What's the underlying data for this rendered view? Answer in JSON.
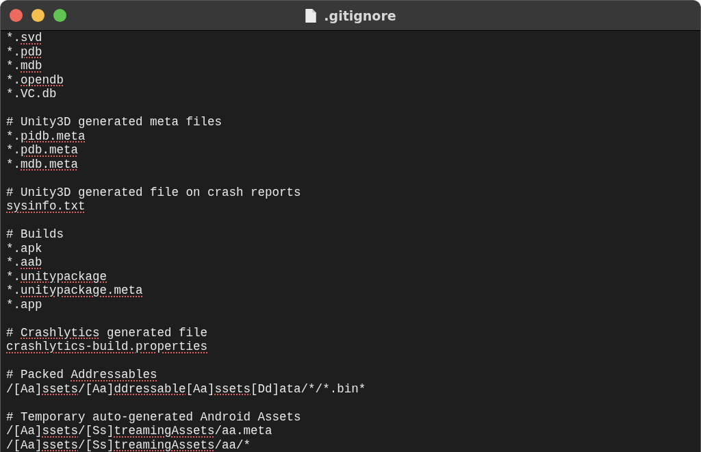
{
  "window": {
    "title": ".gitignore"
  },
  "blocks": [
    {
      "lines": [
        [
          {
            "text": "*.",
            "misspelled": false
          },
          {
            "text": "svd",
            "misspelled": true
          }
        ],
        [
          {
            "text": "*.",
            "misspelled": false
          },
          {
            "text": "pdb",
            "misspelled": true
          }
        ],
        [
          {
            "text": "*.",
            "misspelled": false
          },
          {
            "text": "mdb",
            "misspelled": true
          }
        ],
        [
          {
            "text": "*.",
            "misspelled": false
          },
          {
            "text": "opendb",
            "misspelled": true
          }
        ],
        [
          {
            "text": "*.VC.db",
            "misspelled": false
          }
        ]
      ]
    },
    {
      "lines": [
        [
          {
            "text": "# Unity3D generated meta files",
            "misspelled": false
          }
        ],
        [
          {
            "text": "*.",
            "misspelled": false
          },
          {
            "text": "pidb.meta",
            "misspelled": true
          }
        ],
        [
          {
            "text": "*.",
            "misspelled": false
          },
          {
            "text": "pdb.meta",
            "misspelled": true
          }
        ],
        [
          {
            "text": "*.",
            "misspelled": false
          },
          {
            "text": "mdb.meta",
            "misspelled": true
          }
        ]
      ]
    },
    {
      "lines": [
        [
          {
            "text": "# Unity3D generated file on crash reports",
            "misspelled": false
          }
        ],
        [
          {
            "text": "sysinfo.txt",
            "misspelled": true
          }
        ]
      ]
    },
    {
      "lines": [
        [
          {
            "text": "# Builds",
            "misspelled": false
          }
        ],
        [
          {
            "text": "*.apk",
            "misspelled": false
          }
        ],
        [
          {
            "text": "*.",
            "misspelled": false
          },
          {
            "text": "aab",
            "misspelled": true
          }
        ],
        [
          {
            "text": "*.",
            "misspelled": false
          },
          {
            "text": "unitypackage",
            "misspelled": true
          }
        ],
        [
          {
            "text": "*.",
            "misspelled": false
          },
          {
            "text": "unitypackage.meta",
            "misspelled": true
          }
        ],
        [
          {
            "text": "*.app",
            "misspelled": false
          }
        ]
      ]
    },
    {
      "lines": [
        [
          {
            "text": "# ",
            "misspelled": false
          },
          {
            "text": "Crashlytics",
            "misspelled": true
          },
          {
            "text": " generated file",
            "misspelled": false
          }
        ],
        [
          {
            "text": "crashlytics-build.properties",
            "misspelled": true
          }
        ]
      ]
    },
    {
      "lines": [
        [
          {
            "text": "# Packed ",
            "misspelled": false
          },
          {
            "text": "Addressables",
            "misspelled": true
          }
        ],
        [
          {
            "text": "/[Aa]",
            "misspelled": false
          },
          {
            "text": "ssets",
            "misspelled": true
          },
          {
            "text": "/[Aa]",
            "misspelled": false
          },
          {
            "text": "ddressable",
            "misspelled": true
          },
          {
            "text": "[Aa]",
            "misspelled": false
          },
          {
            "text": "ssets",
            "misspelled": true
          },
          {
            "text": "[Dd]ata/*/*.bin*",
            "misspelled": false
          }
        ]
      ]
    },
    {
      "lines": [
        [
          {
            "text": "# Temporary auto-generated Android Assets",
            "misspelled": false
          }
        ],
        [
          {
            "text": "/[Aa]",
            "misspelled": false
          },
          {
            "text": "ssets",
            "misspelled": true
          },
          {
            "text": "/[Ss]",
            "misspelled": false
          },
          {
            "text": "treamingAssets",
            "misspelled": true
          },
          {
            "text": "/aa.meta",
            "misspelled": false
          }
        ],
        [
          {
            "text": "/[Aa]",
            "misspelled": false
          },
          {
            "text": "ssets",
            "misspelled": true
          },
          {
            "text": "/[Ss]",
            "misspelled": false
          },
          {
            "text": "treamingAssets",
            "misspelled": true
          },
          {
            "text": "/aa/*",
            "misspelled": false
          }
        ]
      ]
    }
  ]
}
